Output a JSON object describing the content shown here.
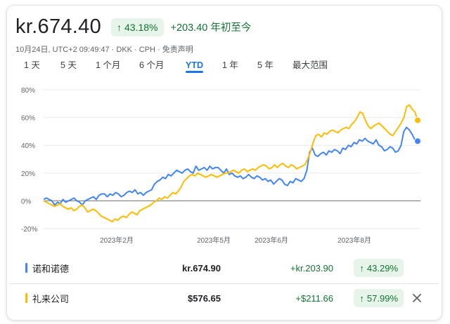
{
  "header": {
    "price": "kr.674.40",
    "change_arrow": "↑",
    "change_pct": "43.18%",
    "change_abs": "+203.40",
    "change_period": "年初至今",
    "meta": "10月24日, UTC+2 09:49:47 · DKK · CPH · 免责声明"
  },
  "ranges": [
    {
      "label": "1 天",
      "active": false
    },
    {
      "label": "5 天",
      "active": false
    },
    {
      "label": "1 个月",
      "active": false
    },
    {
      "label": "6 个月",
      "active": false
    },
    {
      "label": "YTD",
      "active": true
    },
    {
      "label": "1 年",
      "active": false
    },
    {
      "label": "5 年",
      "active": false
    },
    {
      "label": "最大范围",
      "active": false
    }
  ],
  "chart_data": {
    "type": "line",
    "y_ticks": [
      "80%",
      "60%",
      "40%",
      "20%",
      "0%",
      "-20%"
    ],
    "x_ticks": [
      "2023年2月",
      "2023年5月",
      "2023年6月",
      "2023年8月"
    ],
    "ylim": [
      -20,
      80
    ],
    "grid": true,
    "series": [
      {
        "name": "诺和诺德",
        "color": "#4285f4",
        "values": [
          1,
          2,
          1,
          0,
          -3,
          -1,
          -2,
          1,
          -1,
          0,
          1,
          2,
          0,
          -1,
          -3,
          0,
          1,
          2,
          3,
          1,
          4,
          5,
          5,
          3,
          5,
          4,
          6,
          5,
          3,
          4,
          6,
          7,
          6,
          8,
          5,
          6,
          4,
          6,
          7,
          8,
          12,
          14,
          15,
          17,
          16,
          19,
          18,
          20,
          22,
          21,
          20,
          22,
          23,
          21,
          20,
          25,
          22,
          23,
          24,
          22,
          25,
          23,
          24,
          24,
          22,
          20,
          23,
          19,
          20,
          18,
          17,
          18,
          16,
          17,
          19,
          17,
          16,
          18,
          17,
          15,
          16,
          14,
          15,
          12,
          14,
          16,
          15,
          12,
          11,
          14,
          13,
          16,
          15,
          14,
          16,
          22,
          35,
          38,
          33,
          32,
          34,
          35,
          33,
          36,
          35,
          37,
          36,
          34,
          38,
          37,
          40,
          39,
          42,
          41,
          44,
          43,
          45,
          43,
          42,
          41,
          44,
          40,
          39,
          36,
          37,
          39,
          38,
          35,
          36,
          40,
          50,
          53,
          51,
          48,
          44,
          43
        ]
      },
      {
        "name": "礼来公司",
        "color": "#fbbc04",
        "values": [
          0,
          -1,
          -2,
          -3,
          -4,
          -3,
          -2,
          -4,
          -5,
          -6,
          -5,
          -7,
          -6,
          -4,
          -3,
          -5,
          -8,
          -7,
          -6,
          -7,
          -9,
          -11,
          -12,
          -13,
          -14,
          -15,
          -13,
          -14,
          -12,
          -11,
          -12,
          -10,
          -8,
          -9,
          -10,
          -7,
          -6,
          -5,
          -4,
          -3,
          -1,
          0,
          2,
          1,
          3,
          2,
          4,
          6,
          5,
          7,
          10,
          14,
          16,
          18,
          19,
          18,
          20,
          19,
          18,
          17,
          18,
          19,
          18,
          17,
          18,
          19,
          20,
          20,
          21,
          22,
          21,
          20,
          22,
          23,
          21,
          22,
          23,
          22,
          24,
          25,
          26,
          25,
          23,
          24,
          26,
          24,
          26,
          27,
          25,
          24,
          26,
          25,
          23,
          24,
          25,
          26,
          30,
          35,
          42,
          47,
          48,
          46,
          49,
          48,
          50,
          51,
          50,
          49,
          51,
          52,
          53,
          52,
          55,
          57,
          60,
          64,
          63,
          58,
          54,
          52,
          54,
          55,
          56,
          54,
          52,
          50,
          48,
          47,
          50,
          53,
          56,
          60,
          68,
          69,
          66,
          64,
          58
        ]
      }
    ]
  },
  "legend": [
    {
      "name": "诺和诺德",
      "price": "kr.674.90",
      "delta": "+kr.203.90",
      "arrow": "↑",
      "pct": "43.29%",
      "color": "#4285f4"
    },
    {
      "name": "礼来公司",
      "price": "$576.65",
      "delta": "+$211.66",
      "arrow": "↑",
      "pct": "57.99%",
      "color": "#fbbc04",
      "close_icon": "close-icon"
    }
  ]
}
